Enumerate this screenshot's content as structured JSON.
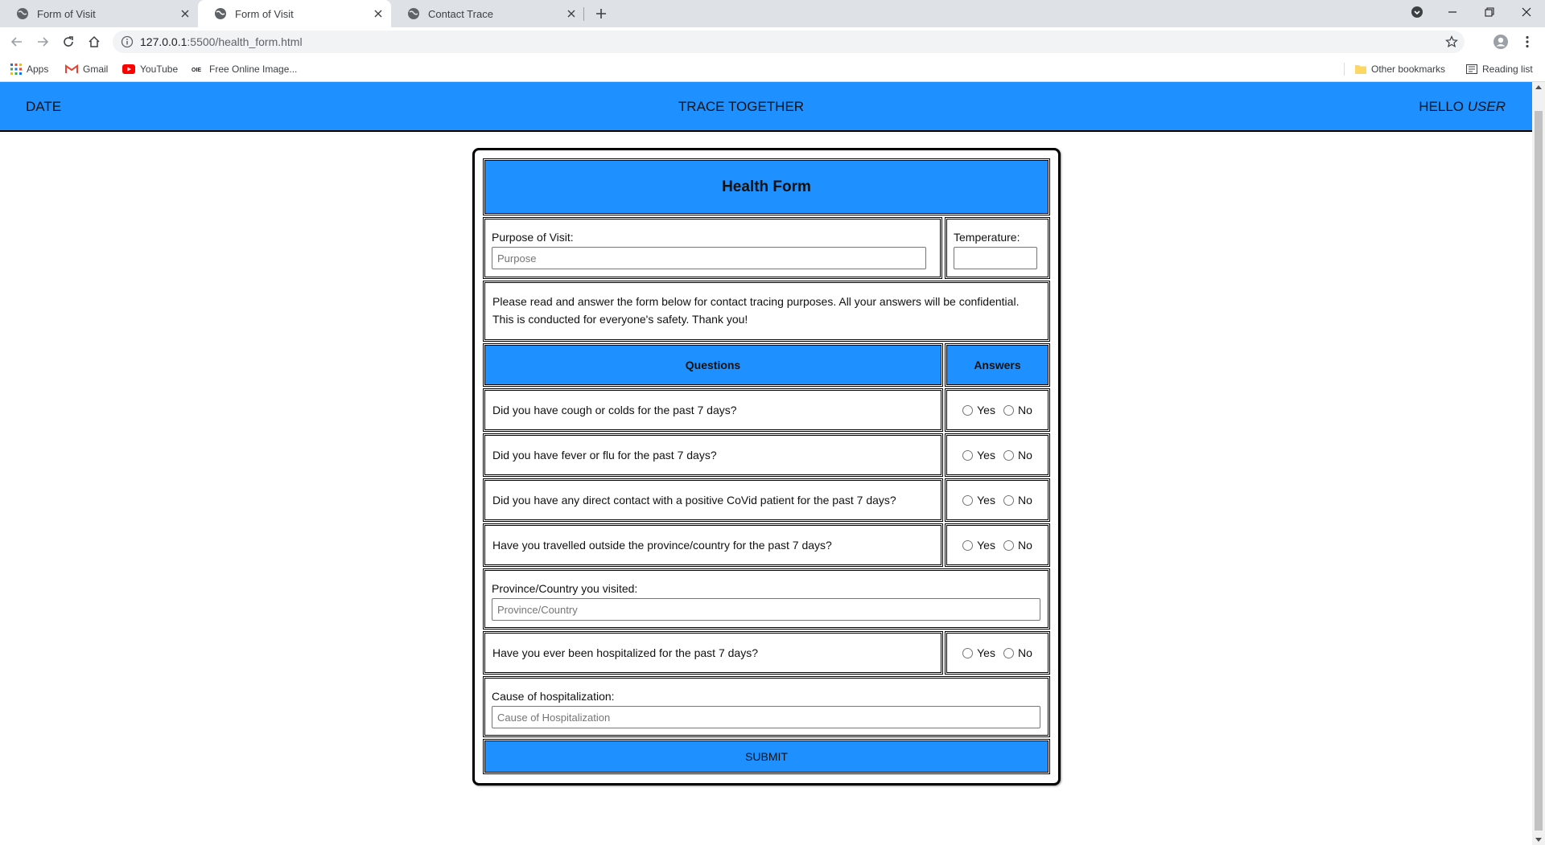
{
  "browser": {
    "tabs": [
      {
        "title": "Form of Visit",
        "active": false
      },
      {
        "title": "Form of Visit",
        "active": true
      },
      {
        "title": "Contact Trace",
        "active": false
      }
    ],
    "url_host": "127.0.0.1",
    "url_path": ":5500/health_form.html",
    "bookmarks": [
      "Apps",
      "Gmail",
      "YouTube",
      "Free Online Image..."
    ],
    "other_bookmarks": "Other bookmarks",
    "reading_list": "Reading list"
  },
  "header": {
    "date": "DATE",
    "brand": "TRACE TOGETHER",
    "greeting": "HELLO",
    "user": "USER"
  },
  "form": {
    "title": "Health Form",
    "purpose_label": "Purpose of Visit:",
    "purpose_placeholder": "Purpose",
    "temperature_label": "Temperature:",
    "notice_line1": "Please read and answer the form below for contact tracing purposes. All your answers will be confidential.",
    "notice_line2": "This is conducted for everyone's safety. Thank you!",
    "col_questions": "Questions",
    "col_answers": "Answers",
    "questions": [
      "Did you have cough or colds for the past 7 days?",
      "Did you have fever or flu for the past 7 days?",
      "Did you have any direct contact with a positive CoVid patient for the past 7 days?",
      "Have you travelled outside the province/country for the past 7 days?",
      "Have you ever been hospitalized for the past 7 days?"
    ],
    "yes": "Yes",
    "no": "No",
    "province_label": "Province/Country you visited:",
    "province_placeholder": "Province/Country",
    "cause_label": "Cause of hospitalization:",
    "cause_placeholder": "Cause of Hospitalization",
    "submit": "SUBMIT"
  },
  "colors": {
    "accent": "#1e90ff"
  }
}
